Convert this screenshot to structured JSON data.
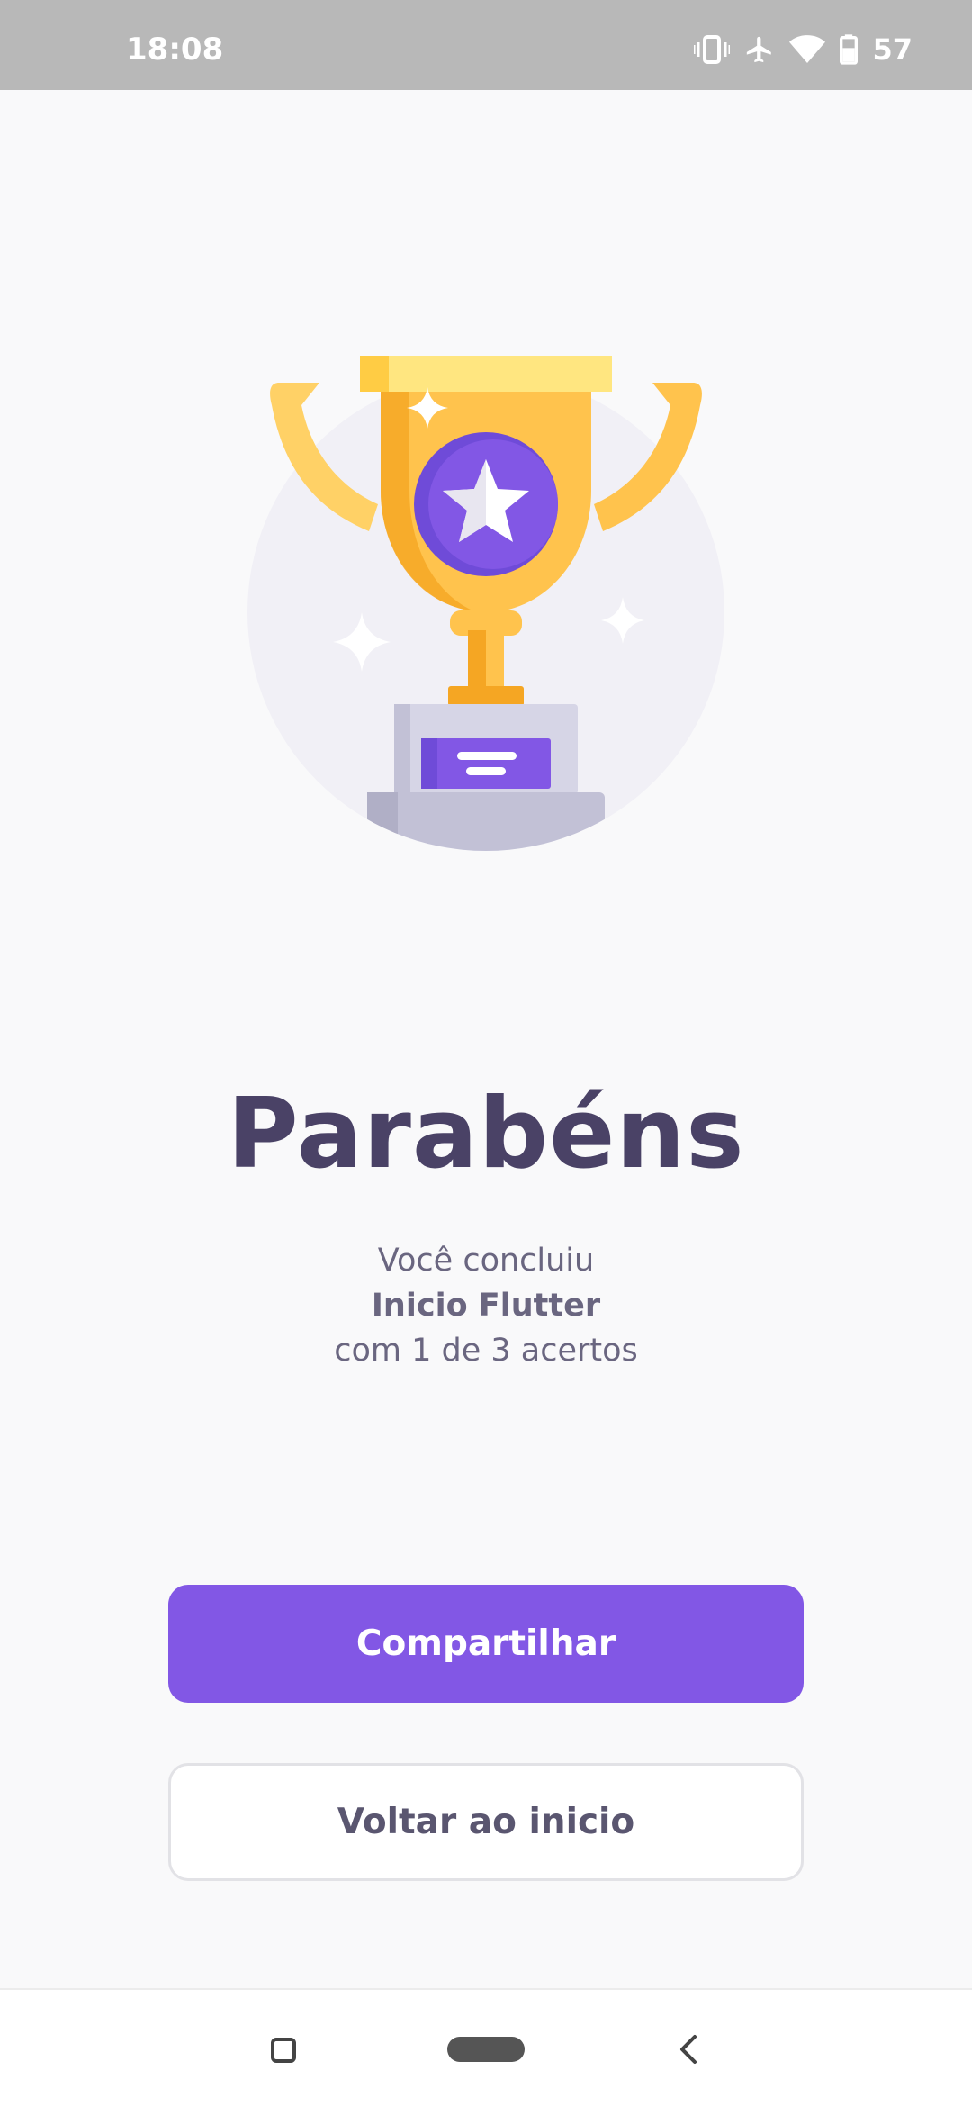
{
  "status_bar": {
    "time": "18:08",
    "battery_level": "57",
    "icons": [
      "vibrate-icon",
      "airplane-mode-icon",
      "wifi-icon",
      "battery-icon"
    ]
  },
  "result": {
    "title": "Parabéns",
    "line1": "Você concluiu",
    "course": "Inicio Flutter",
    "line3": "com 1 de 3 acertos"
  },
  "actions": {
    "share_label": "Compartilhar",
    "back_label": "Voltar ao inicio"
  },
  "navigation": {
    "icons": [
      "recents-icon",
      "home-pill-icon",
      "back-icon"
    ]
  },
  "colors": {
    "primary": "#8257e5",
    "title": "#4a4266",
    "trophy_gold": "#ffc34d",
    "status_bar": "#b8b8b8"
  }
}
